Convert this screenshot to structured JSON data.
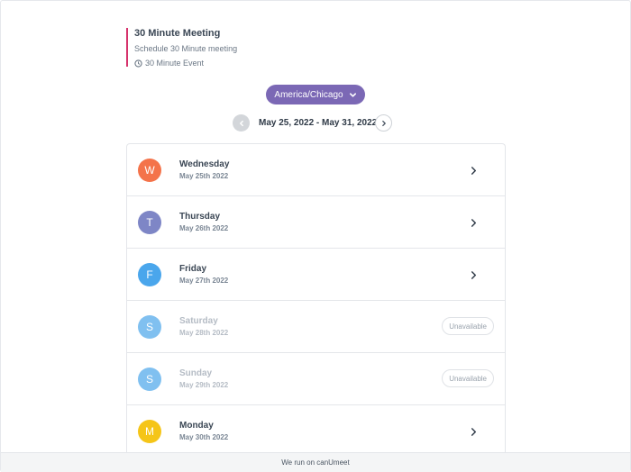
{
  "event": {
    "title": "30 Minute Meeting",
    "subtitle": "Schedule 30 Minute meeting",
    "duration_label": "30 Minute Event",
    "accent_color": "#d6336c"
  },
  "timezone": {
    "label": "America/Chicago",
    "color": "#7b68b5"
  },
  "date_nav": {
    "range": "May 25, 2022 - May 31, 2022"
  },
  "days": [
    {
      "initial": "W",
      "name": "Wednesday",
      "date": "May 25th 2022",
      "color": "#f4734a",
      "available": true
    },
    {
      "initial": "T",
      "name": "Thursday",
      "date": "May 26th 2022",
      "color": "#7e86c6",
      "available": true
    },
    {
      "initial": "F",
      "name": "Friday",
      "date": "May 27th 2022",
      "color": "#4aa6ec",
      "available": true
    },
    {
      "initial": "S",
      "name": "Saturday",
      "date": "May 28th 2022",
      "color": "#80c0f0",
      "available": false,
      "status": "Unavailable"
    },
    {
      "initial": "S",
      "name": "Sunday",
      "date": "May 29th 2022",
      "color": "#80c0f0",
      "available": false,
      "status": "Unavailable"
    },
    {
      "initial": "M",
      "name": "Monday",
      "date": "May 30th 2022",
      "color": "#f5c518",
      "available": true
    }
  ],
  "footer": {
    "text": "We run on canUmeet"
  }
}
